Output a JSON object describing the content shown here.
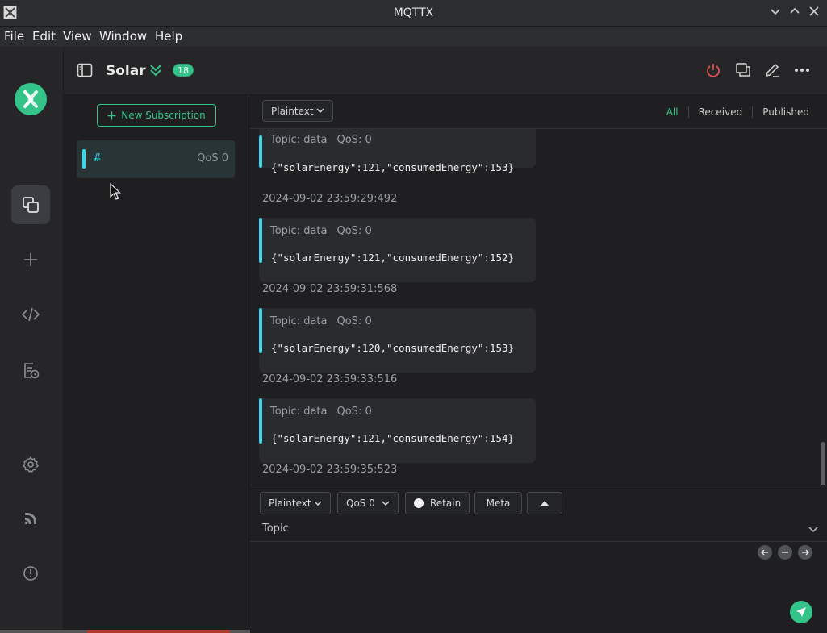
{
  "window": {
    "title": "MQTTX",
    "controls": [
      "chevron-down-icon",
      "chevron-up-icon",
      "close-icon"
    ]
  },
  "menu": [
    "File",
    "Edit",
    "View",
    "Window",
    "Help"
  ],
  "connection": {
    "name": "Solar",
    "count": "18"
  },
  "subscriptions": {
    "new_label": "New Subscription",
    "items": [
      {
        "topic": "#",
        "qos": "QoS 0"
      }
    ]
  },
  "message_toolbar": {
    "format": "Plaintext",
    "filters": [
      "All",
      "Received",
      "Published"
    ],
    "active_filter": "All"
  },
  "messages": [
    {
      "topic_label": "Topic: data",
      "qos_label": "QoS: 0",
      "payload": "{\"solarEnergy\":121,\"consumedEnergy\":153}",
      "time": "2024-09-02 23:59:29:492"
    },
    {
      "topic_label": "Topic: data",
      "qos_label": "QoS: 0",
      "payload": "{\"solarEnergy\":121,\"consumedEnergy\":152}",
      "time": "2024-09-02 23:59:31:568"
    },
    {
      "topic_label": "Topic: data",
      "qos_label": "QoS: 0",
      "payload": "{\"solarEnergy\":120,\"consumedEnergy\":153}",
      "time": "2024-09-02 23:59:33:516"
    },
    {
      "topic_label": "Topic: data",
      "qos_label": "QoS: 0",
      "payload": "{\"solarEnergy\":121,\"consumedEnergy\":154}",
      "time": "2024-09-02 23:59:35:523"
    }
  ],
  "composer": {
    "format": "Plaintext",
    "qos": "QoS 0",
    "retain_label": "Retain",
    "meta_label": "Meta",
    "topic_placeholder": "Topic"
  },
  "colors": {
    "accent": "#34c388",
    "topic_bar": "#3ed6e8",
    "disconnect": "#e5534b"
  }
}
